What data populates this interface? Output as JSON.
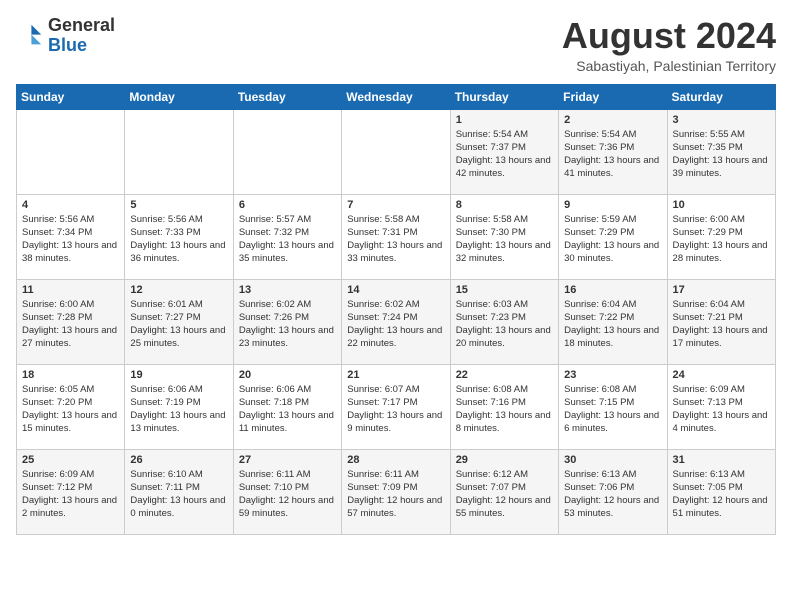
{
  "logo": {
    "general": "General",
    "blue": "Blue"
  },
  "header": {
    "title": "August 2024",
    "subtitle": "Sabastiyah, Palestinian Territory"
  },
  "weekdays": [
    "Sunday",
    "Monday",
    "Tuesday",
    "Wednesday",
    "Thursday",
    "Friday",
    "Saturday"
  ],
  "weeks": [
    [
      {
        "day": "",
        "sunrise": "",
        "sunset": "",
        "daylight": ""
      },
      {
        "day": "",
        "sunrise": "",
        "sunset": "",
        "daylight": ""
      },
      {
        "day": "",
        "sunrise": "",
        "sunset": "",
        "daylight": ""
      },
      {
        "day": "",
        "sunrise": "",
        "sunset": "",
        "daylight": ""
      },
      {
        "day": "1",
        "sunrise": "Sunrise: 5:54 AM",
        "sunset": "Sunset: 7:37 PM",
        "daylight": "Daylight: 13 hours and 42 minutes."
      },
      {
        "day": "2",
        "sunrise": "Sunrise: 5:54 AM",
        "sunset": "Sunset: 7:36 PM",
        "daylight": "Daylight: 13 hours and 41 minutes."
      },
      {
        "day": "3",
        "sunrise": "Sunrise: 5:55 AM",
        "sunset": "Sunset: 7:35 PM",
        "daylight": "Daylight: 13 hours and 39 minutes."
      }
    ],
    [
      {
        "day": "4",
        "sunrise": "Sunrise: 5:56 AM",
        "sunset": "Sunset: 7:34 PM",
        "daylight": "Daylight: 13 hours and 38 minutes."
      },
      {
        "day": "5",
        "sunrise": "Sunrise: 5:56 AM",
        "sunset": "Sunset: 7:33 PM",
        "daylight": "Daylight: 13 hours and 36 minutes."
      },
      {
        "day": "6",
        "sunrise": "Sunrise: 5:57 AM",
        "sunset": "Sunset: 7:32 PM",
        "daylight": "Daylight: 13 hours and 35 minutes."
      },
      {
        "day": "7",
        "sunrise": "Sunrise: 5:58 AM",
        "sunset": "Sunset: 7:31 PM",
        "daylight": "Daylight: 13 hours and 33 minutes."
      },
      {
        "day": "8",
        "sunrise": "Sunrise: 5:58 AM",
        "sunset": "Sunset: 7:30 PM",
        "daylight": "Daylight: 13 hours and 32 minutes."
      },
      {
        "day": "9",
        "sunrise": "Sunrise: 5:59 AM",
        "sunset": "Sunset: 7:29 PM",
        "daylight": "Daylight: 13 hours and 30 minutes."
      },
      {
        "day": "10",
        "sunrise": "Sunrise: 6:00 AM",
        "sunset": "Sunset: 7:29 PM",
        "daylight": "Daylight: 13 hours and 28 minutes."
      }
    ],
    [
      {
        "day": "11",
        "sunrise": "Sunrise: 6:00 AM",
        "sunset": "Sunset: 7:28 PM",
        "daylight": "Daylight: 13 hours and 27 minutes."
      },
      {
        "day": "12",
        "sunrise": "Sunrise: 6:01 AM",
        "sunset": "Sunset: 7:27 PM",
        "daylight": "Daylight: 13 hours and 25 minutes."
      },
      {
        "day": "13",
        "sunrise": "Sunrise: 6:02 AM",
        "sunset": "Sunset: 7:26 PM",
        "daylight": "Daylight: 13 hours and 23 minutes."
      },
      {
        "day": "14",
        "sunrise": "Sunrise: 6:02 AM",
        "sunset": "Sunset: 7:24 PM",
        "daylight": "Daylight: 13 hours and 22 minutes."
      },
      {
        "day": "15",
        "sunrise": "Sunrise: 6:03 AM",
        "sunset": "Sunset: 7:23 PM",
        "daylight": "Daylight: 13 hours and 20 minutes."
      },
      {
        "day": "16",
        "sunrise": "Sunrise: 6:04 AM",
        "sunset": "Sunset: 7:22 PM",
        "daylight": "Daylight: 13 hours and 18 minutes."
      },
      {
        "day": "17",
        "sunrise": "Sunrise: 6:04 AM",
        "sunset": "Sunset: 7:21 PM",
        "daylight": "Daylight: 13 hours and 17 minutes."
      }
    ],
    [
      {
        "day": "18",
        "sunrise": "Sunrise: 6:05 AM",
        "sunset": "Sunset: 7:20 PM",
        "daylight": "Daylight: 13 hours and 15 minutes."
      },
      {
        "day": "19",
        "sunrise": "Sunrise: 6:06 AM",
        "sunset": "Sunset: 7:19 PM",
        "daylight": "Daylight: 13 hours and 13 minutes."
      },
      {
        "day": "20",
        "sunrise": "Sunrise: 6:06 AM",
        "sunset": "Sunset: 7:18 PM",
        "daylight": "Daylight: 13 hours and 11 minutes."
      },
      {
        "day": "21",
        "sunrise": "Sunrise: 6:07 AM",
        "sunset": "Sunset: 7:17 PM",
        "daylight": "Daylight: 13 hours and 9 minutes."
      },
      {
        "day": "22",
        "sunrise": "Sunrise: 6:08 AM",
        "sunset": "Sunset: 7:16 PM",
        "daylight": "Daylight: 13 hours and 8 minutes."
      },
      {
        "day": "23",
        "sunrise": "Sunrise: 6:08 AM",
        "sunset": "Sunset: 7:15 PM",
        "daylight": "Daylight: 13 hours and 6 minutes."
      },
      {
        "day": "24",
        "sunrise": "Sunrise: 6:09 AM",
        "sunset": "Sunset: 7:13 PM",
        "daylight": "Daylight: 13 hours and 4 minutes."
      }
    ],
    [
      {
        "day": "25",
        "sunrise": "Sunrise: 6:09 AM",
        "sunset": "Sunset: 7:12 PM",
        "daylight": "Daylight: 13 hours and 2 minutes."
      },
      {
        "day": "26",
        "sunrise": "Sunrise: 6:10 AM",
        "sunset": "Sunset: 7:11 PM",
        "daylight": "Daylight: 13 hours and 0 minutes."
      },
      {
        "day": "27",
        "sunrise": "Sunrise: 6:11 AM",
        "sunset": "Sunset: 7:10 PM",
        "daylight": "Daylight: 12 hours and 59 minutes."
      },
      {
        "day": "28",
        "sunrise": "Sunrise: 6:11 AM",
        "sunset": "Sunset: 7:09 PM",
        "daylight": "Daylight: 12 hours and 57 minutes."
      },
      {
        "day": "29",
        "sunrise": "Sunrise: 6:12 AM",
        "sunset": "Sunset: 7:07 PM",
        "daylight": "Daylight: 12 hours and 55 minutes."
      },
      {
        "day": "30",
        "sunrise": "Sunrise: 6:13 AM",
        "sunset": "Sunset: 7:06 PM",
        "daylight": "Daylight: 12 hours and 53 minutes."
      },
      {
        "day": "31",
        "sunrise": "Sunrise: 6:13 AM",
        "sunset": "Sunset: 7:05 PM",
        "daylight": "Daylight: 12 hours and 51 minutes."
      }
    ]
  ]
}
